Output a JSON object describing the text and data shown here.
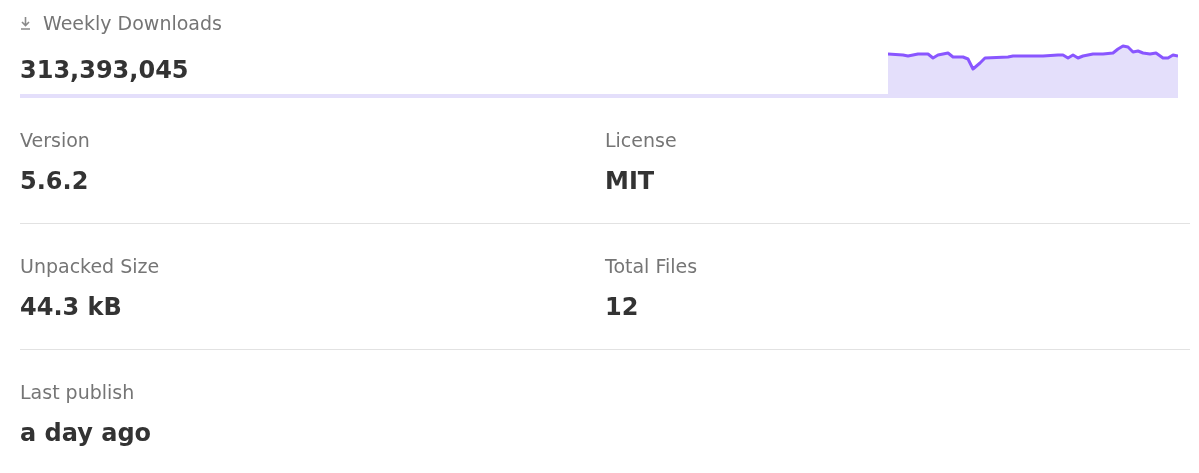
{
  "downloads": {
    "label": "Weekly Downloads",
    "value": "313,393,045"
  },
  "stats": [
    {
      "label": "Version",
      "value": "5.6.2"
    },
    {
      "label": "License",
      "value": "MIT"
    },
    {
      "label": "Unpacked Size",
      "value": "44.3 kB"
    },
    {
      "label": "Total Files",
      "value": "12"
    },
    {
      "label": "Last publish",
      "value": "a day ago"
    }
  ]
}
